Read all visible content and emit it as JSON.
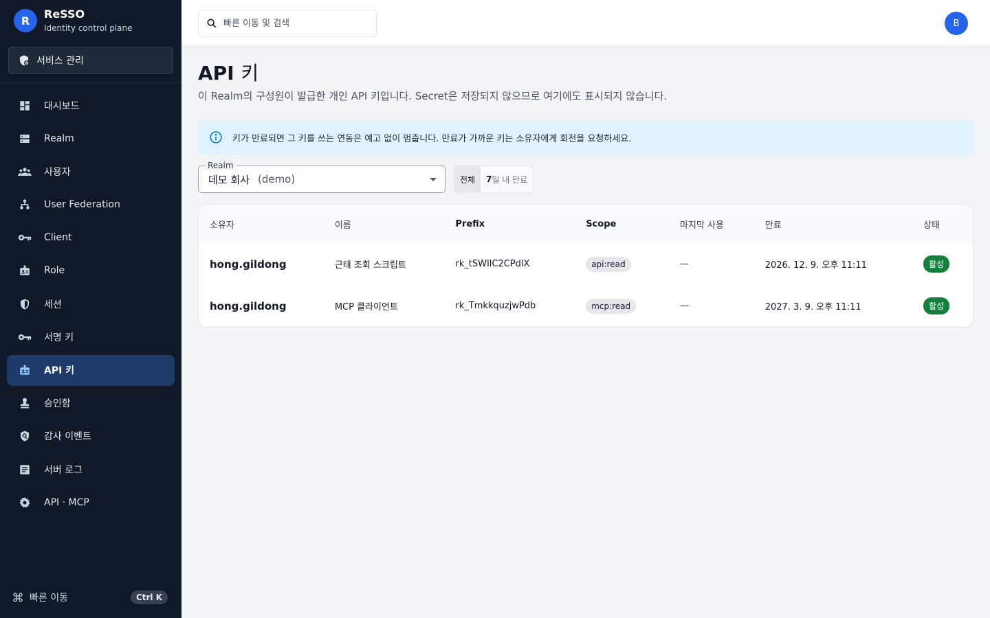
{
  "brand": {
    "logo": "R",
    "name": "ReSSO",
    "subtitle": "Identity control plane"
  },
  "service_button": {
    "label": "서비스 관리",
    "icon": "shield-settings-icon"
  },
  "nav": [
    {
      "label": "대시보드",
      "icon": "dashboard-icon"
    },
    {
      "label": "Realm",
      "icon": "server-icon"
    },
    {
      "label": "사용자",
      "icon": "users-icon"
    },
    {
      "label": "User Federation",
      "icon": "hierarchy-icon"
    },
    {
      "label": "Client",
      "icon": "key-icon"
    },
    {
      "label": "Role",
      "icon": "badge-icon"
    },
    {
      "label": "세션",
      "icon": "shield-icon"
    },
    {
      "label": "서명 키",
      "icon": "key-icon"
    },
    {
      "label": "API 키",
      "icon": "badge-icon",
      "active": true
    },
    {
      "label": "승인함",
      "icon": "approval-icon"
    },
    {
      "label": "감사 이벤트",
      "icon": "audit-icon"
    },
    {
      "label": "서버 로그",
      "icon": "log-icon"
    },
    {
      "label": "API · MCP",
      "icon": "gear-icon"
    }
  ],
  "sidebar_footer": {
    "label": "빠른 이동",
    "shortcut": "Ctrl K"
  },
  "topbar": {
    "search_placeholder": "빠른 이동 및 검색",
    "avatar": "B"
  },
  "page": {
    "title_prefix": "API",
    "title_suffix": "키",
    "description": "이 Realm의 구성원이 발급한 개인 API 키입니다. Secret은 저장되지 않으므로 여기에도 표시되지 않습니다."
  },
  "alert": {
    "text": "키가 만료되면 그 키를 쓰는 연동은 예고 없이 멈춥니다. 만료가 가까운 키는 소유자에게 회전을 요청하세요."
  },
  "filters": {
    "realm_label": "Realm",
    "realm_name": "데모 회사",
    "realm_code": "(demo)",
    "segments": {
      "all": "전체",
      "expiring_num": "7",
      "expiring_rest": "일 내 만료"
    }
  },
  "table": {
    "columns": {
      "owner": "소유자",
      "name": "이름",
      "prefix": "Prefix",
      "scope": "Scope",
      "last_used": "마지막 사용",
      "expires": "만료",
      "status": "상태"
    },
    "rows": [
      {
        "owner": "hong.gildong",
        "name": "근태 조회 스크립트",
        "prefix": "rk_tSWIlC2CPdlX",
        "scope": "api:read",
        "last_used": "—",
        "expires": "2026. 12. 9. 오후 11:11",
        "status": "활성"
      },
      {
        "owner": "hong.gildong",
        "name": "MCP 클라이언트",
        "prefix": "rk_TmkkquzjwPdb",
        "scope": "mcp:read",
        "last_used": "—",
        "expires": "2027. 3. 9. 오후 11:11",
        "status": "활성"
      }
    ]
  },
  "colors": {
    "sidebar_bg": "#111827",
    "active_nav": "#1e3a68",
    "accent": "#2563eb",
    "status_active": "#15803d",
    "alert_bg": "#e0f2fe"
  }
}
